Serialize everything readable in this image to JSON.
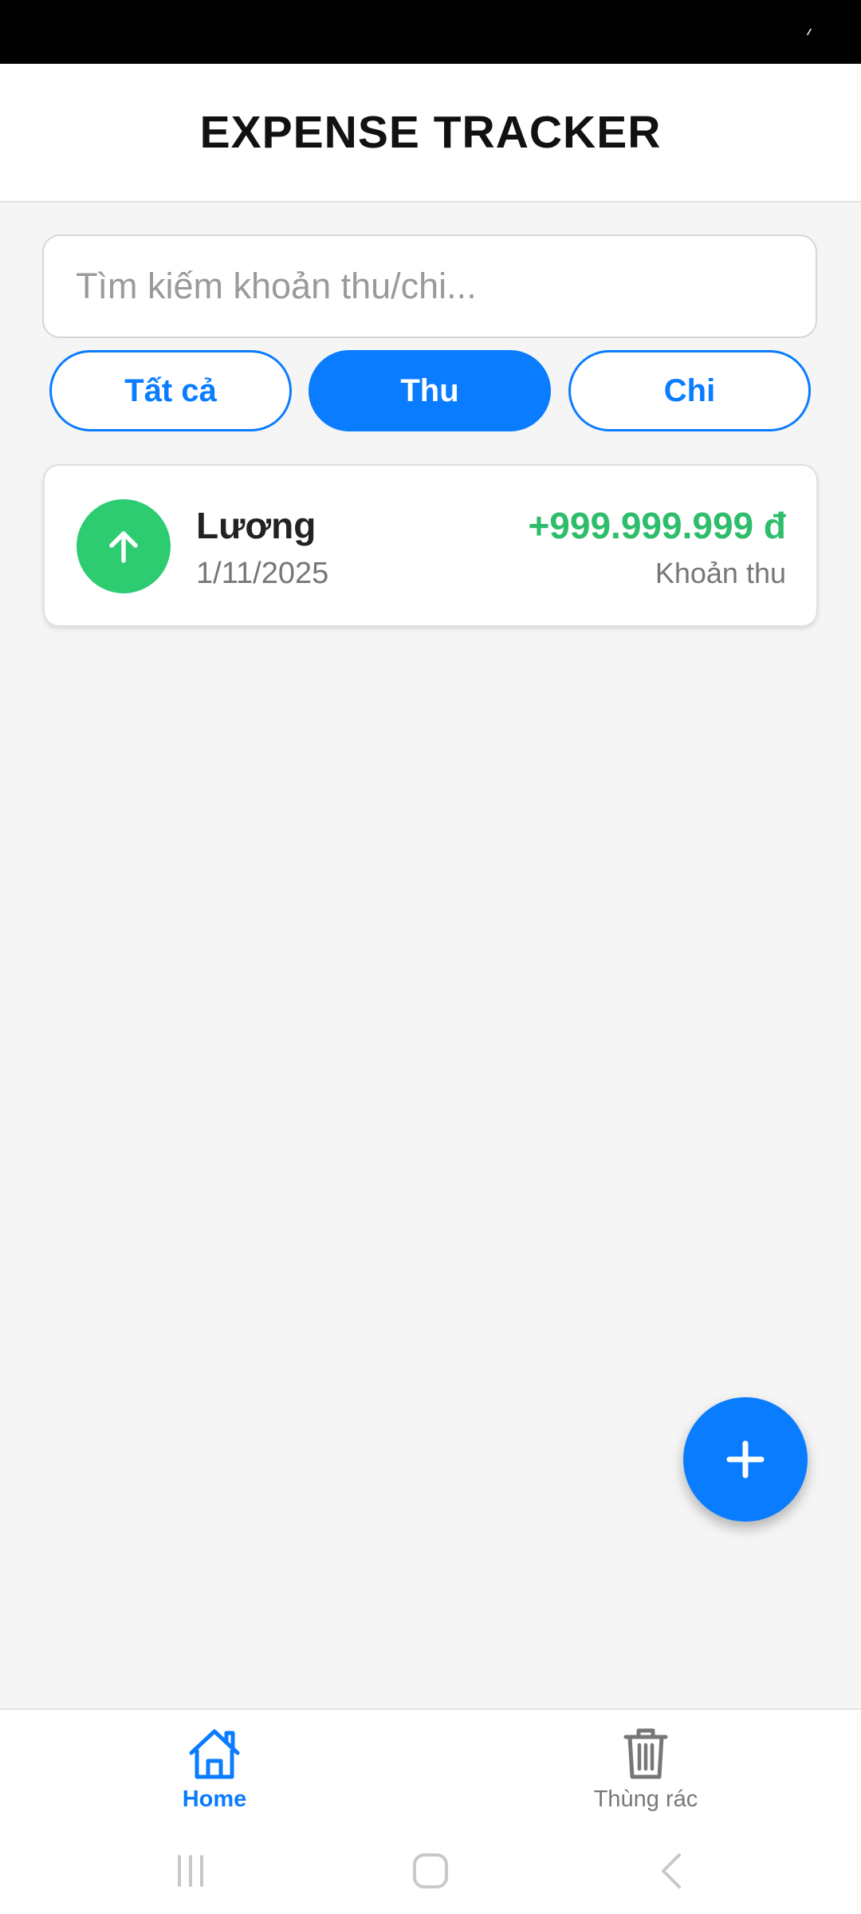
{
  "header": {
    "title": "EXPENSE TRACKER"
  },
  "search": {
    "placeholder": "Tìm kiếm khoản thu/chi..."
  },
  "filters": [
    {
      "label": "Tất cả",
      "active": false
    },
    {
      "label": "Thu",
      "active": true
    },
    {
      "label": "Chi",
      "active": false
    }
  ],
  "transactions": [
    {
      "name": "Lương",
      "date": "1/11/2025",
      "amount": "+999.999.999 đ",
      "type": "Khoản thu",
      "icon": "arrow-up-icon",
      "color": "#2ecc71"
    }
  ],
  "fab": {
    "icon": "plus-icon"
  },
  "bottom_nav": {
    "home_label": "Home",
    "trash_label": "Thùng rác",
    "home_icon": "home-icon",
    "trash_icon": "trash-icon"
  },
  "colors": {
    "primary": "#0a7cff",
    "income": "#2ecc71",
    "income_text": "#2ebd6b"
  }
}
